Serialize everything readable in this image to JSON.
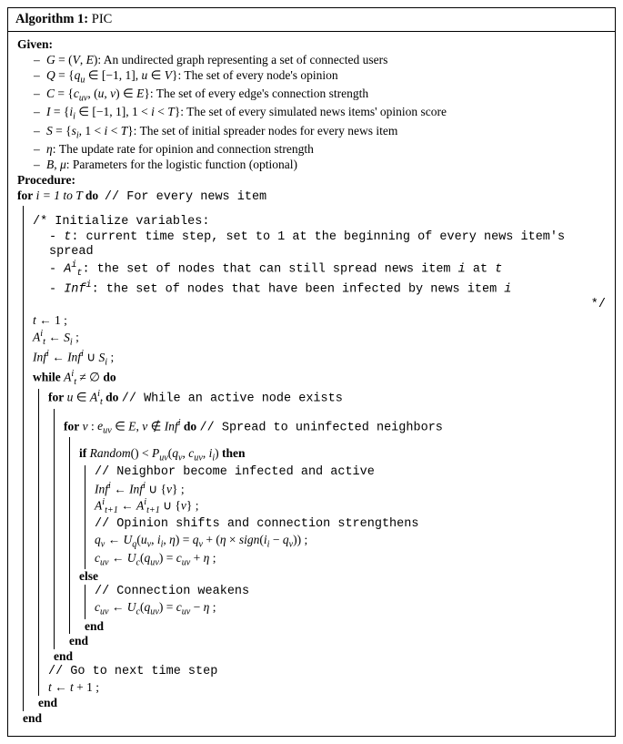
{
  "algo": {
    "title_label": "Algorithm 1:",
    "title_name": "PIC",
    "given_label": "Given:",
    "given_items": [
      "G = (V, E): An undirected graph representing a set of connected users",
      "Q = {q_u ∈ [−1, 1], u ∈ V}: The set of every node's opinion",
      "C = {c_uv, (u, v) ∈ E}: The set of every edge's connection strength",
      "I = {i_i ∈ [−1, 1], 1 < i < T}: The set of every simulated news items' opinion score",
      "S = {s_i, 1 < i < T}: The set of initial spreader nodes for every news item",
      "η: The update rate for opinion and connection strength",
      "B, μ: Parameters for the logistic function (optional)"
    ],
    "procedure_label": "Procedure:",
    "for_outer": "for",
    "for_outer_cond": "i = 1 to T",
    "do": "do",
    "end": "end",
    "while": "while",
    "else": "else",
    "if": "if",
    "then": "then",
    "comment_for_every_news": "// For every news item",
    "init_comment_head": "/* Initialize variables:",
    "init_comment_t": "- t: current time step, set to 1 at the beginning of every news item's spread",
    "init_comment_A": "- A_t^i: the set of nodes that can still spread news item i at t",
    "init_comment_Inf": "- Inf^i: the set of nodes that have been infected by news item i",
    "init_comment_close": "*/",
    "stmt_t1": "t ← 1 ;",
    "stmt_A": "A_t^i ← S_i ;",
    "stmt_Inf": "Inf^i ← Inf^i ∪ S_i ;",
    "while_cond": "A_t^i ≠ ∅",
    "for_u": "u ∈ A_t^i",
    "comment_while_active": "// While an active node exists",
    "for_v": "v : e_uv ∈ E, v ∉ Inf^i",
    "comment_spread": "// Spread to uninfected neighbors",
    "if_cond": "Random() < P_uv(q_v, c_uv, i_i)",
    "comment_infected": "// Neighbor become infected and active",
    "stmt_inf_v": "Inf^i ← Inf^i ∪ {v} ;",
    "stmt_A_v": "A_{t+1}^i ← A_{t+1}^i ∪ {v} ;",
    "comment_opinion": "// Opinion shifts and connection strengthens",
    "stmt_qv": "q_v ← U_q(u_v, i_i, η) = q_v + (η × sign(i_i − q_v)) ;",
    "stmt_cuv_plus": "c_uv ← U_c(q_uv) = c_uv + η ;",
    "comment_weaken": "// Connection weakens",
    "stmt_cuv_minus": "c_uv ← U_c(q_uv) = c_uv − η ;",
    "comment_next": "// Go to next time step",
    "stmt_tplus": "t ← t + 1 ;"
  }
}
